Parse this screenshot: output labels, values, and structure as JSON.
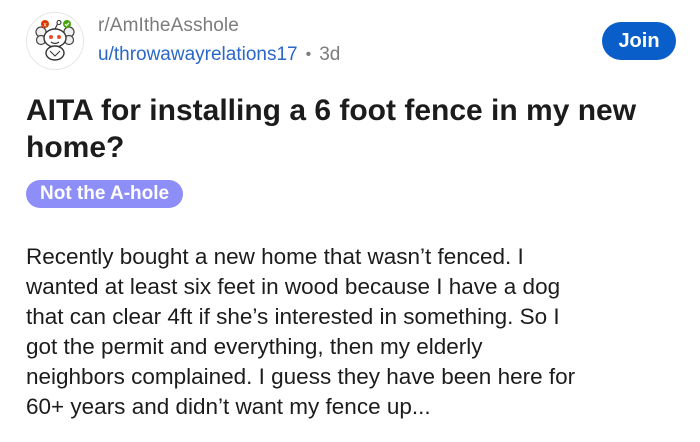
{
  "header": {
    "subreddit": "r/AmItheAsshole",
    "username": "u/throwawayrelations17",
    "separator": "•",
    "age": "3d",
    "avatar_icon": "snoo-judge-icon"
  },
  "actions": {
    "join_label": "Join",
    "join_color": "#0a5ec9"
  },
  "post": {
    "title": "AITA for installing a 6 foot fence in my new home?",
    "flair": "Not the A-hole",
    "flair_color": "#8e8ef8",
    "body_lines": [
      "Recently bought a new home that wasn’t fenced. I",
      "wanted at least six feet in wood because I have a dog",
      "that can clear 4ft if she’s interested in something. So I",
      "got the permit and everything, then my elderly",
      "neighbors complained. I guess they have been here for",
      "60+ years and didn’t want my fence up..."
    ]
  }
}
